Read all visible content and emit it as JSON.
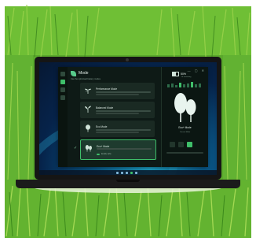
{
  "app": {
    "title": "Mode",
    "subtitle": "Use the optimised battery modes",
    "window_controls": "— ▢ ✕"
  },
  "modes": [
    {
      "name": "Performance Mode",
      "icon": "sprout-icon",
      "selected": false
    },
    {
      "name": "Balanced Mode",
      "icon": "seedling-icon",
      "selected": false
    },
    {
      "name": "Eco Mode",
      "icon": "plant-icon",
      "selected": false
    },
    {
      "name": "Eco+ Mode",
      "icon": "trees-icon",
      "selected": true,
      "sub_option": "Enable tabs"
    }
  ],
  "status": {
    "battery_percent": "50%",
    "battery_level": 0.5,
    "battery_sub": "1h remaining",
    "current_mode": "Eco+ Mode",
    "current_mode_sub": "Current Mode"
  },
  "colors": {
    "accent": "#3fbf6a",
    "panel": "#0e1a16",
    "card": "#1a2a23"
  }
}
